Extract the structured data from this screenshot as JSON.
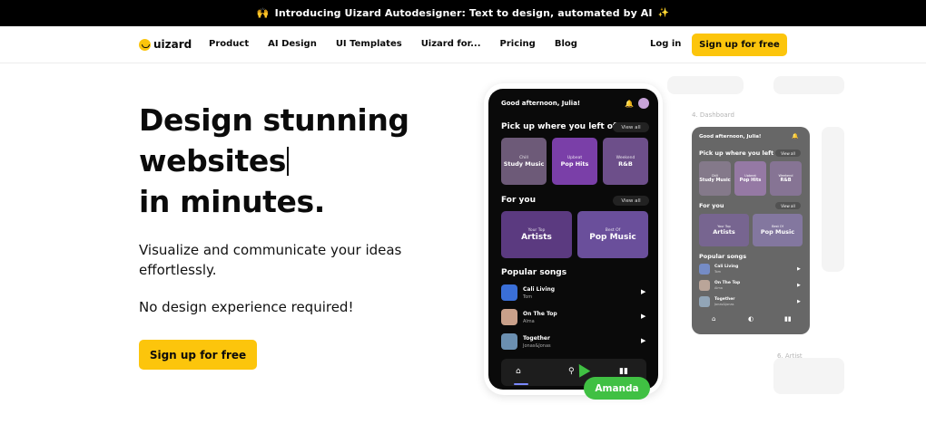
{
  "announcement": {
    "emoji": "🙌",
    "text": "Introducing Uizard Autodesigner: Text to design, automated by AI",
    "sparkle": "✨"
  },
  "nav": {
    "logo": "uizard",
    "items": [
      "Product",
      "AI Design",
      "UI Templates",
      "Uizard for...",
      "Pricing",
      "Blog"
    ],
    "login": "Log in",
    "cta": "Sign up for free"
  },
  "hero": {
    "title_lines": [
      "Design stunning",
      "websites",
      "in minutes."
    ],
    "subtitle": "Visualize and communicate your ideas effortlessly.",
    "subtitle2": "No design experience required!",
    "cta": "Sign up for free"
  },
  "phone": {
    "greeting": "Good afternoon, Julia!",
    "section1": "Pick up where you left off",
    "view_all": "View all",
    "tiles1": [
      {
        "small": "Chill",
        "label": "Study Music",
        "color": "#6d5a78"
      },
      {
        "small": "Upbeat",
        "label": "Pop Hits",
        "color": "#7a3fa8"
      },
      {
        "small": "Weekend",
        "label": "R&B",
        "color": "#6d4f8a"
      }
    ],
    "section2": "For you",
    "tiles2": [
      {
        "small": "Your Top",
        "label": "Artists",
        "color": "#5b3a80"
      },
      {
        "small": "Best Of",
        "label": "Pop Music",
        "color": "#6a4f9b"
      }
    ],
    "section3": "Popular songs",
    "songs": [
      {
        "title": "Cali Living",
        "artist": "Tom",
        "color": "#3a6fd8"
      },
      {
        "title": "On The Top",
        "artist": "Alma",
        "color": "#c9a08a"
      },
      {
        "title": "Together",
        "artist": "Jonas&Jonas",
        "color": "#6b8fb0"
      }
    ]
  },
  "mini_screen": {
    "greeting": "Good afternoon, Julia!",
    "section1": "Pick up where you left off",
    "view_all": "View all",
    "tiles1": [
      {
        "small": "Chill",
        "label": "Study Music"
      },
      {
        "small": "Upbeat",
        "label": "Pop Hits"
      },
      {
        "small": "Weekend",
        "label": "R&B"
      }
    ],
    "section2": "For you",
    "tiles2": [
      {
        "small": "Your Top",
        "label": "Artists"
      },
      {
        "small": "Best Of",
        "label": "Pop Music"
      }
    ],
    "section3": "Popular songs",
    "songs": [
      {
        "title": "Cali Living",
        "artist": "Tom"
      },
      {
        "title": "On The Top",
        "artist": "Alma"
      },
      {
        "title": "Together",
        "artist": "Jonas&Jonas"
      }
    ]
  },
  "ghost_labels": {
    "dashboard": "4. Dashboard",
    "artist": "6. Artist"
  },
  "collaborator": "Amanda",
  "colors": {
    "accent": "#fcc50c",
    "collab": "#40c043"
  }
}
